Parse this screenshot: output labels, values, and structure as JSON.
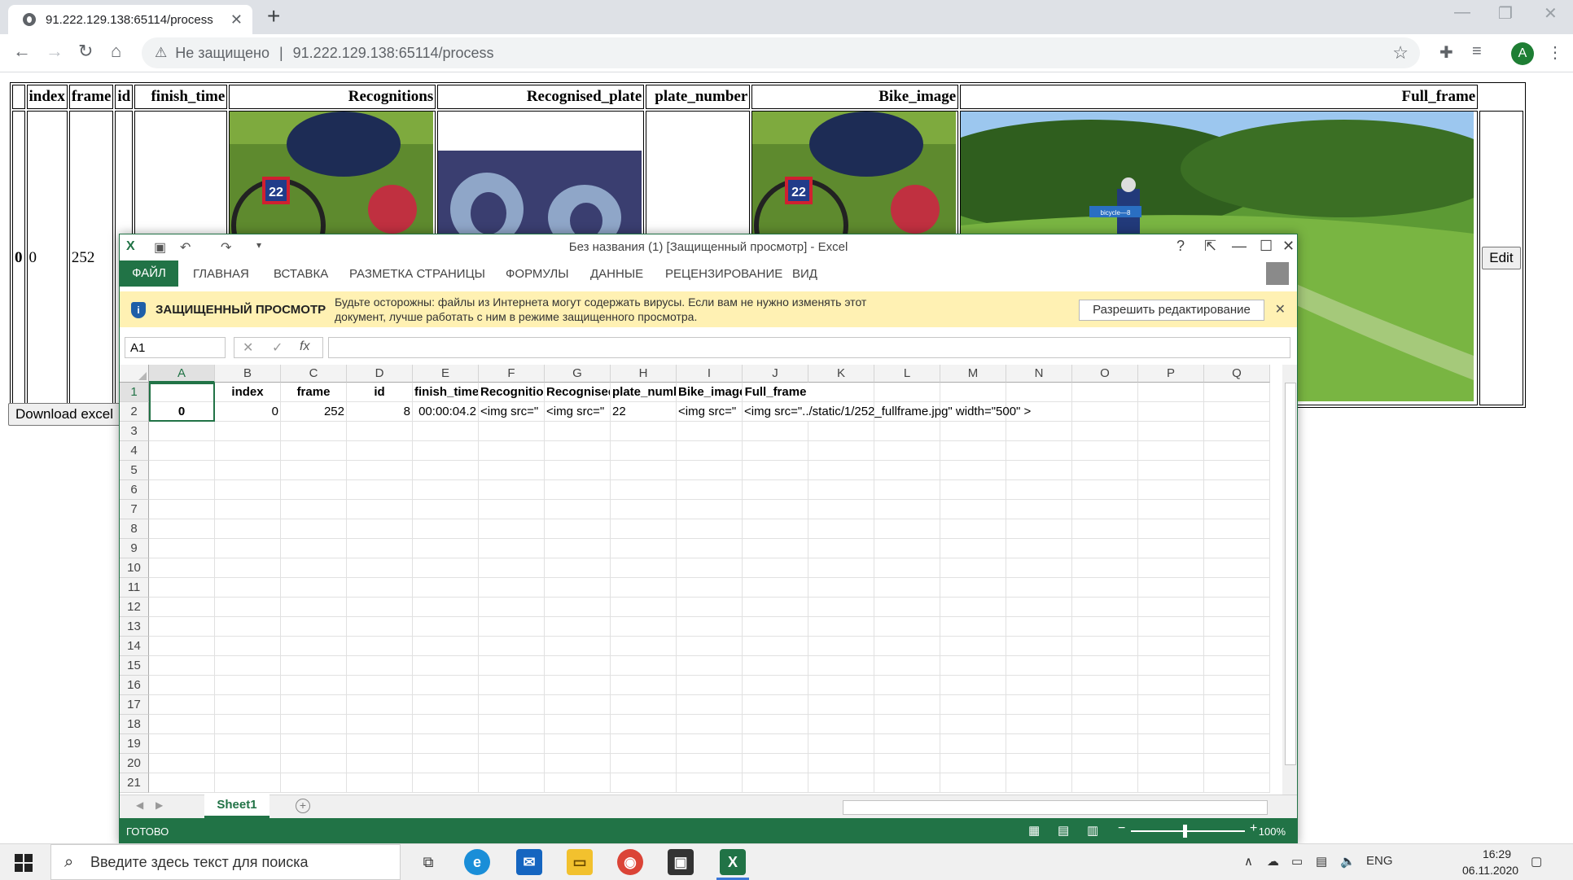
{
  "browser": {
    "tab_title": "91.222.129.138:65114/process",
    "not_secure": "Не защищено",
    "url": "91.222.129.138:65114/process",
    "avatar_letter": "A"
  },
  "webpage": {
    "columns": [
      "index",
      "frame",
      "id",
      "finish_time",
      "Recognitions",
      "Recognised_plate",
      "plate_number",
      "Bike_image",
      "Full_frame"
    ],
    "row": {
      "label": "0",
      "index": "0",
      "frame": "252",
      "id": "",
      "finish_time": "",
      "plate_number": ""
    },
    "bike_number": "22",
    "detection_label": "bicycle—8",
    "edit_label": "Edit",
    "download_label": "Download excel"
  },
  "excel": {
    "title": "Без названия (1)  [Защищенный просмотр] - Excel",
    "ribbon_tabs": [
      "ФАЙЛ",
      "ГЛАВНАЯ",
      "ВСТАВКА",
      "РАЗМЕТКА СТРАНИЦЫ",
      "ФОРМУЛЫ",
      "ДАННЫЕ",
      "РЕЦЕНЗИРОВАНИЕ",
      "ВИД"
    ],
    "protected_view": {
      "heading": "ЗАЩИЩЕННЫЙ ПРОСМОТР",
      "message": "Будьте осторожны: файлы из Интернета могут содержать вирусы. Если вам не нужно изменять этот документ, лучше работать с ним в режиме защищенного просмотра.",
      "enable_button": "Разрешить редактирование"
    },
    "name_box": "A1",
    "fx_symbol": "fx",
    "columns": [
      "A",
      "B",
      "C",
      "D",
      "E",
      "F",
      "G",
      "H",
      "I",
      "J",
      "K",
      "L",
      "M",
      "N",
      "O",
      "P",
      "Q"
    ],
    "rows": [
      "1",
      "2",
      "3",
      "4",
      "5",
      "6",
      "7",
      "8",
      "9",
      "10",
      "11",
      "12",
      "13",
      "14",
      "15",
      "16",
      "17",
      "18",
      "19",
      "20",
      "21"
    ],
    "header_row": [
      "",
      "index",
      "frame",
      "id",
      "finish_time",
      "Recognitions",
      "Recognised_plate",
      "plate_number",
      "Bike_image",
      "Full_frame"
    ],
    "data_row": [
      "0",
      "0",
      "252",
      "8",
      "00:00:04.2",
      "<img src=\"",
      "<img src=\"",
      "22",
      "<img src=\"",
      "<img src=\"../static/1/252_fullframe.jpg\" width=\"500\" >"
    ],
    "sheet_name": "Sheet1",
    "status": "ГОТОВО",
    "zoom": "100%"
  },
  "taskbar": {
    "search_placeholder": "Введите здесь текст для поиска",
    "language": "ENG",
    "time": "16:29",
    "date": "06.11.2020"
  },
  "colors": {
    "excel_green": "#217346",
    "warning_yellow": "#fff1b3",
    "chrome_gray": "#dee1e6"
  }
}
